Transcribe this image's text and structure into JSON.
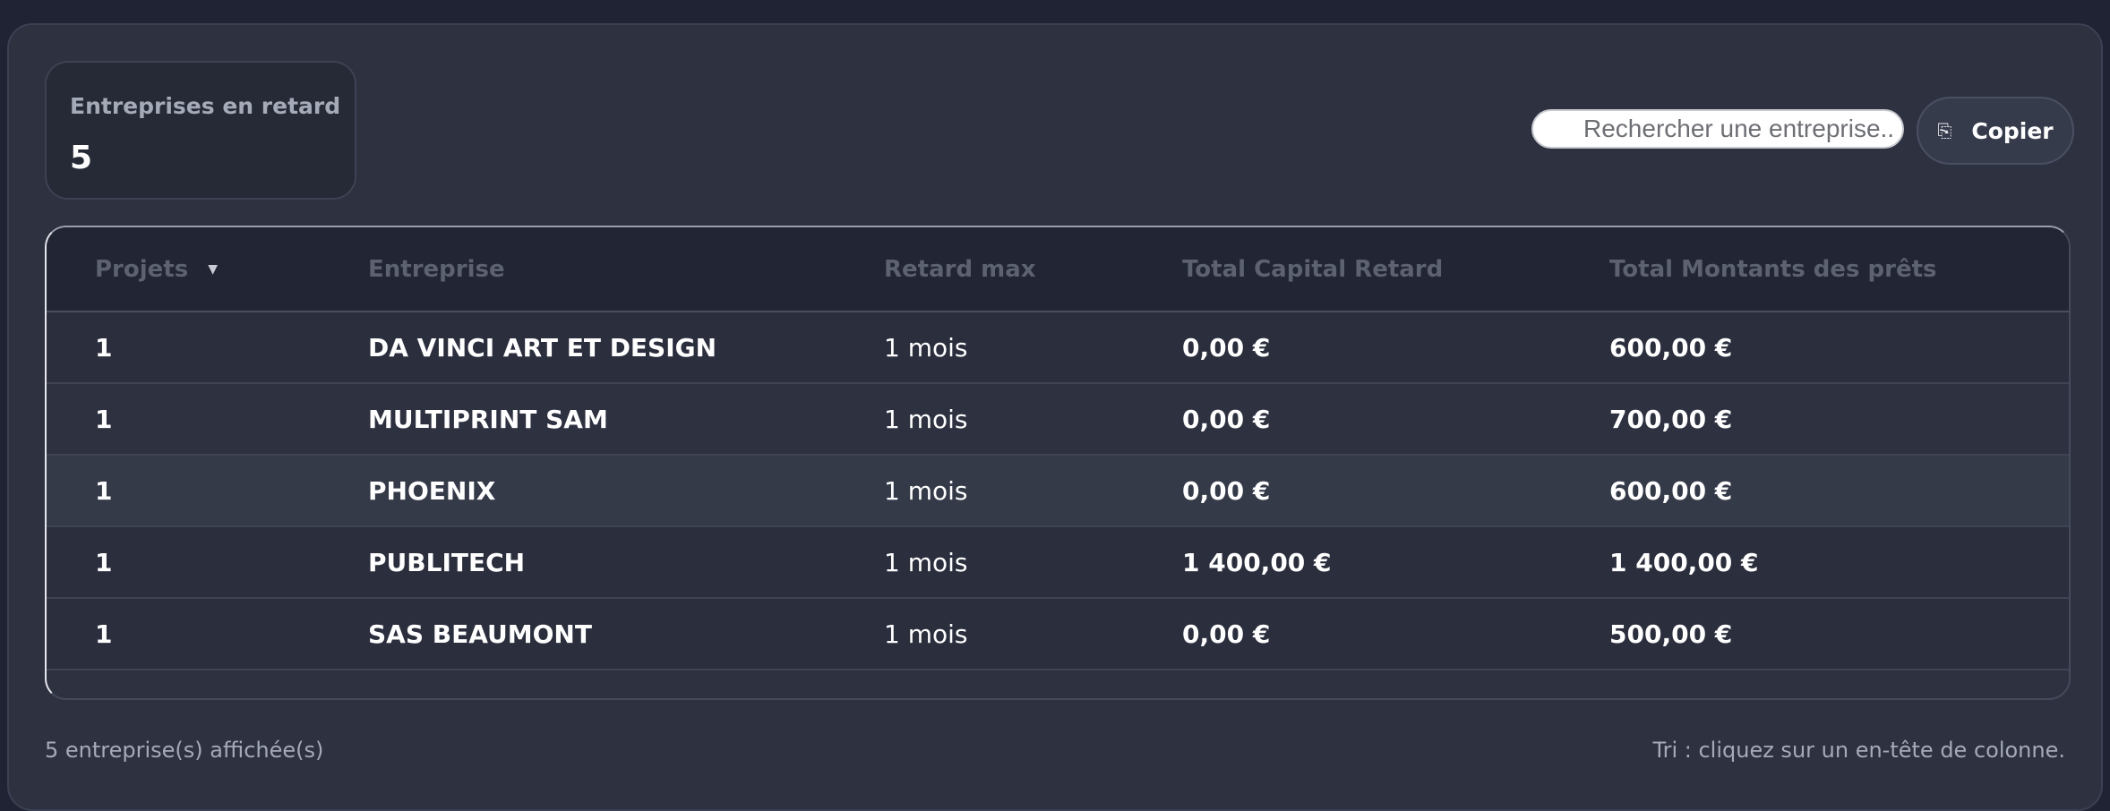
{
  "stat": {
    "label": "Entreprises en retard",
    "value": "5"
  },
  "search": {
    "placeholder": "Rechercher une entreprise...",
    "value": ""
  },
  "copy_button": {
    "icon": "copy-icon",
    "label": "Copier"
  },
  "table": {
    "headers": [
      "Projets",
      "Entreprise",
      "Retard max",
      "Total Capital Retard",
      "Total Montants des prêts"
    ],
    "sort_column": "Projets",
    "rows": [
      {
        "projets": "1",
        "entreprise": "DA VINCI ART ET DESIGN",
        "retard": "1 mois",
        "capital": "0,00 €",
        "montants": "600,00 €"
      },
      {
        "projets": "1",
        "entreprise": "MULTIPRINT SAM",
        "retard": "1 mois",
        "capital": "0,00 €",
        "montants": "700,00 €"
      },
      {
        "projets": "1",
        "entreprise": "PHOENIX",
        "retard": "1 mois",
        "capital": "0,00 €",
        "montants": "600,00 €"
      },
      {
        "projets": "1",
        "entreprise": "PUBLITECH",
        "retard": "1 mois",
        "capital": "1 400,00 €",
        "montants": "1 400,00 €"
      },
      {
        "projets": "1",
        "entreprise": "SAS BEAUMONT",
        "retard": "1 mois",
        "capital": "0,00 €",
        "montants": "500,00 €"
      }
    ]
  },
  "footer": {
    "count_text": "5 entreprise(s) affichée(s)",
    "hint_text": "Tri : cliquez sur un en-tête de colonne."
  },
  "colors": {
    "background": "#1f2333",
    "panel": "#2d3140",
    "header": "#222533",
    "text": "#ffffff",
    "muted": "#a5aab8"
  }
}
